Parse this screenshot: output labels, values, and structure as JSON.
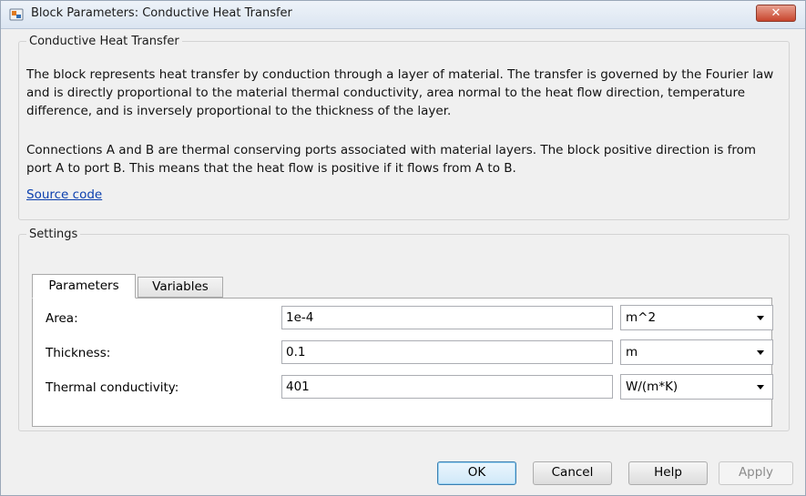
{
  "window": {
    "title": "Block Parameters: Conductive Heat Transfer",
    "close_label": "✕"
  },
  "description": {
    "group_label": "Conductive Heat Transfer",
    "paragraph1": "The block represents heat transfer by conduction through a layer of material. The transfer is governed by the Fourier law and is directly proportional to the material thermal conductivity, area normal to the heat flow direction, temperature difference, and is inversely proportional to the thickness of the layer.",
    "paragraph2": "Connections A and B are thermal conserving ports associated with material layers. The block positive direction is from port A to port B. This means that the heat flow is positive if it flows from A to B.",
    "source_link": "Source code"
  },
  "settings": {
    "group_label": "Settings",
    "tabs": [
      {
        "label": "Parameters",
        "active": true
      },
      {
        "label": "Variables",
        "active": false
      }
    ],
    "rows": [
      {
        "label": "Area:",
        "value": "1e-4",
        "unit": "m^2"
      },
      {
        "label": "Thickness:",
        "value": "0.1",
        "unit": "m"
      },
      {
        "label": "Thermal conductivity:",
        "value": "401",
        "unit": "W/(m*K)"
      }
    ]
  },
  "buttons": {
    "ok": "OK",
    "cancel": "Cancel",
    "help": "Help",
    "apply": "Apply"
  },
  "colors": {
    "link": "#0b3fae",
    "dialog_bg": "#f0f0f0",
    "close_button": "#c7452d"
  }
}
